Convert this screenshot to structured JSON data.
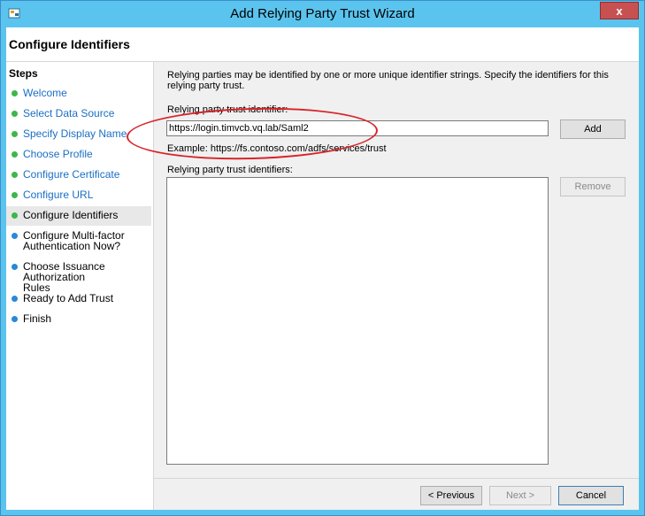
{
  "window": {
    "title": "Add Relying Party Trust Wizard",
    "close_label": "x"
  },
  "header": {
    "title": "Configure Identifiers"
  },
  "steps": {
    "title": "Steps",
    "items": [
      {
        "label": "Welcome",
        "state": "done"
      },
      {
        "label": "Select Data Source",
        "state": "done"
      },
      {
        "label": "Specify Display Name",
        "state": "done"
      },
      {
        "label": "Choose Profile",
        "state": "done"
      },
      {
        "label": "Configure Certificate",
        "state": "done"
      },
      {
        "label": "Configure URL",
        "state": "done"
      },
      {
        "label": "Configure Identifiers",
        "state": "current"
      },
      {
        "label": "Configure Multi-factor Authentication Now?",
        "state": "pending"
      },
      {
        "label": "Choose Issuance Authorization Rules",
        "state": "pending"
      },
      {
        "label": "Ready to Add Trust",
        "state": "pending"
      },
      {
        "label": "Finish",
        "state": "pending"
      }
    ]
  },
  "main": {
    "description": "Relying parties may be identified by one or more unique identifier strings. Specify the identifiers for this relying party trust.",
    "identifier_label": "Relying party trust identifier:",
    "identifier_value": "https://login.timvcb.vq.lab/Saml2",
    "add_label": "Add",
    "example": "Example: https://fs.contoso.com/adfs/services/trust",
    "list_label": "Relying party trust identifiers:",
    "remove_label": "Remove"
  },
  "footer": {
    "previous_label": "< Previous",
    "next_label": "Next >",
    "cancel_label": "Cancel"
  },
  "colors": {
    "titlebar": "#5bc4ee",
    "step_done_dot": "#3fb64a",
    "step_pending_dot": "#2a88d8",
    "annotation": "#d8242a"
  }
}
